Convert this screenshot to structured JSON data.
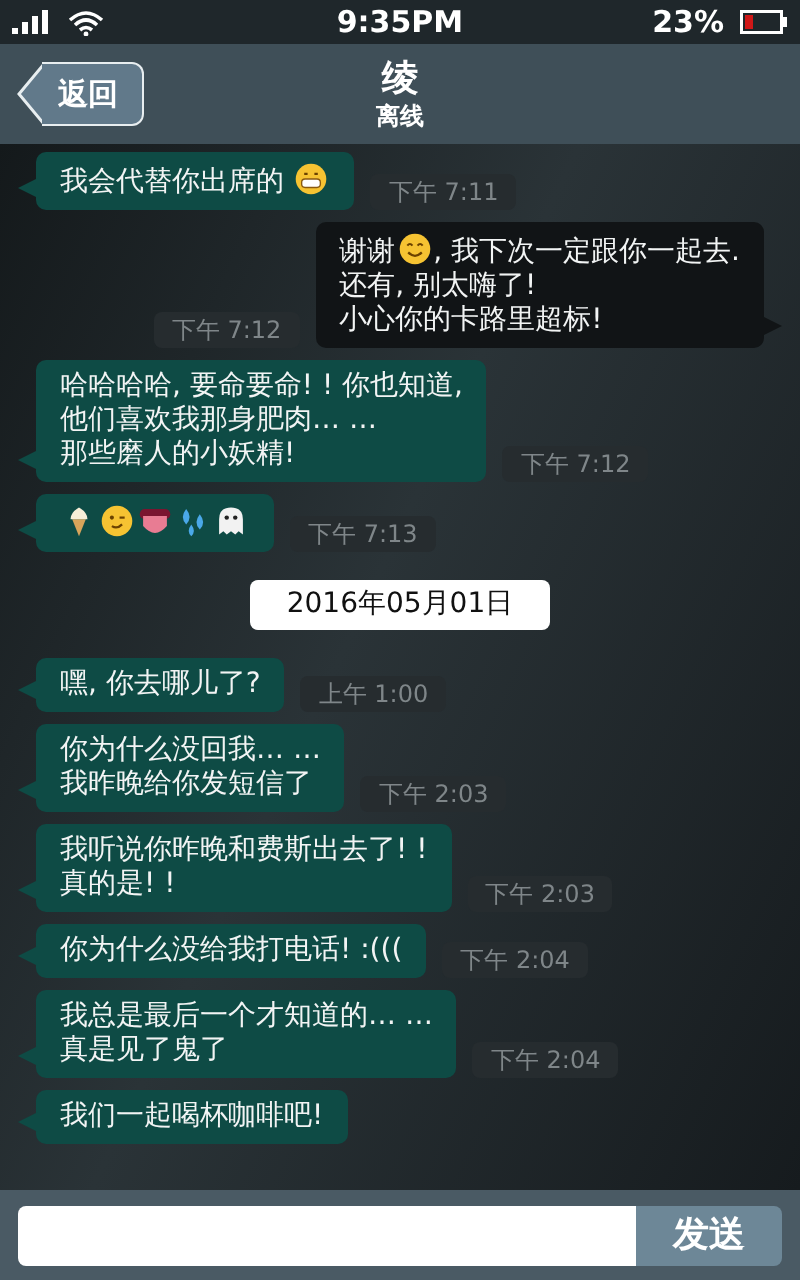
{
  "status_bar": {
    "time": "9:35PM",
    "battery_percent": "23%"
  },
  "header": {
    "back_button": "返回",
    "title": "绫",
    "subtitle": "离线"
  },
  "messages": [
    {
      "kind": "message",
      "outgoing": false,
      "time": "下午 7:11",
      "lines": [
        [
          {
            "kind": "text",
            "text": "我会代替你出席的 "
          },
          {
            "kind": "grin"
          }
        ]
      ]
    },
    {
      "kind": "message",
      "outgoing": true,
      "time": "下午 7:12",
      "lines": [
        [
          {
            "kind": "text",
            "text": "谢谢"
          },
          {
            "kind": "smile"
          },
          {
            "kind": "text",
            "text": ", 我下次一定跟你一起去."
          }
        ],
        [
          {
            "kind": "text",
            "text": "还有, 别太嗨了!"
          }
        ],
        [
          {
            "kind": "text",
            "text": "小心你的卡路里超标!"
          }
        ]
      ]
    },
    {
      "kind": "message",
      "outgoing": false,
      "time": "下午 7:12",
      "lines": [
        [
          {
            "kind": "text",
            "text": "哈哈哈哈, 要命要命! ! 你也知道,"
          }
        ],
        [
          {
            "kind": "text",
            "text": "他们喜欢我那身肥肉… …"
          }
        ],
        [
          {
            "kind": "text",
            "text": "那些磨人的小妖精!"
          }
        ]
      ]
    },
    {
      "kind": "message",
      "outgoing": false,
      "time": "下午 7:13",
      "lines": [
        [
          {
            "kind": "icecream"
          },
          {
            "kind": "wink"
          },
          {
            "kind": "tongue"
          },
          {
            "kind": "drops"
          },
          {
            "kind": "ghost"
          }
        ]
      ]
    },
    {
      "kind": "date",
      "text": "2016年05月01日"
    },
    {
      "kind": "message",
      "outgoing": false,
      "time": "上午 1:00",
      "lines": [
        [
          {
            "kind": "text",
            "text": "嘿, 你去哪儿了?"
          }
        ]
      ]
    },
    {
      "kind": "message",
      "outgoing": false,
      "time": "下午 2:03",
      "lines": [
        [
          {
            "kind": "text",
            "text": "你为什么没回我… …"
          }
        ],
        [
          {
            "kind": "text",
            "text": "我昨晚给你发短信了"
          }
        ]
      ]
    },
    {
      "kind": "message",
      "outgoing": false,
      "time": "下午 2:03",
      "lines": [
        [
          {
            "kind": "text",
            "text": "我听说你昨晚和费斯出去了! !"
          }
        ],
        [
          {
            "kind": "text",
            "text": "真的是! !"
          }
        ]
      ]
    },
    {
      "kind": "message",
      "outgoing": false,
      "time": "下午 2:04",
      "lines": [
        [
          {
            "kind": "text",
            "text": "你为什么没给我打电话! :((("
          }
        ]
      ]
    },
    {
      "kind": "message",
      "outgoing": false,
      "time": "下午 2:04",
      "lines": [
        [
          {
            "kind": "text",
            "text": "我总是最后一个才知道的… …"
          }
        ],
        [
          {
            "kind": "text",
            "text": "真是见了鬼了"
          }
        ]
      ]
    },
    {
      "kind": "message",
      "outgoing": false,
      "lines": [
        [
          {
            "kind": "text",
            "text": "我们一起喝杯咖啡吧!"
          }
        ]
      ]
    }
  ],
  "composer": {
    "send_button": "发送"
  }
}
